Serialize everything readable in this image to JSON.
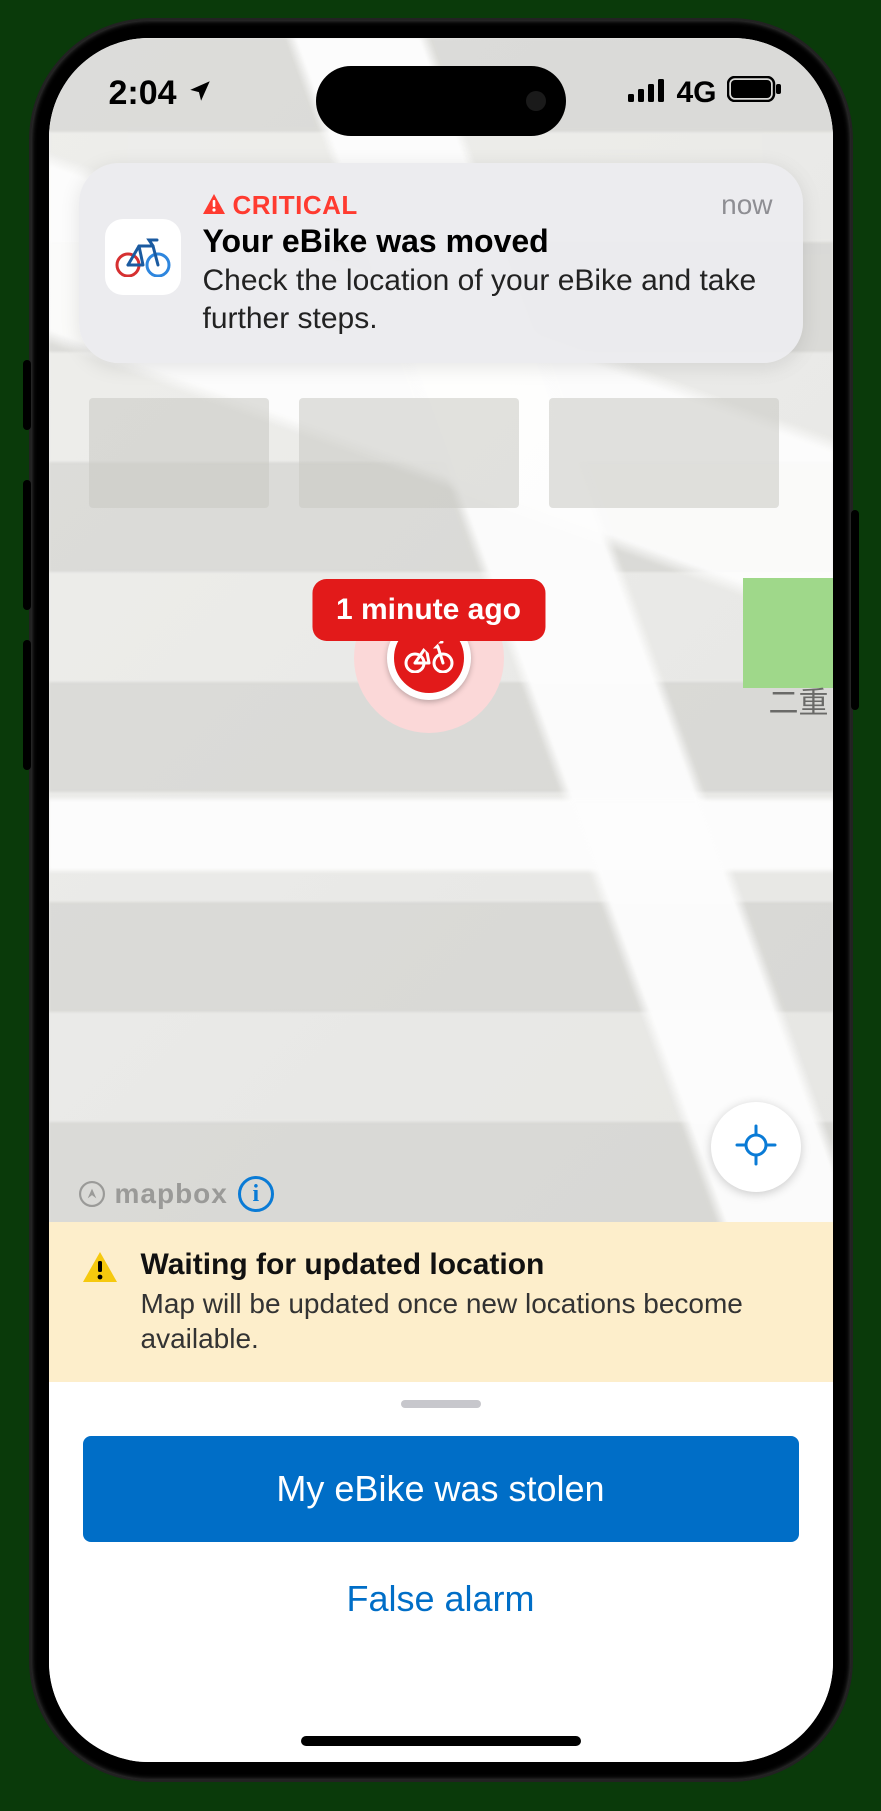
{
  "status": {
    "time": "2:04",
    "network": "4G"
  },
  "notification": {
    "critical_label": "CRITICAL",
    "time_label": "now",
    "title": "Your eBike was moved",
    "message": "Check the location of your eBike and take further steps."
  },
  "map": {
    "marker_tooltip": "1 minute ago",
    "attribution": "mapbox",
    "jp_label": "二重"
  },
  "waiting": {
    "title": "Waiting for updated location",
    "message": "Map will be updated once new locations become available."
  },
  "actions": {
    "stolen_label": "My eBike was stolen",
    "false_alarm_label": "False alarm"
  },
  "colors": {
    "critical": "#ff3b30",
    "marker": "#e21a1a",
    "primary": "#006ec7",
    "warn_bg": "#fdeecb"
  }
}
